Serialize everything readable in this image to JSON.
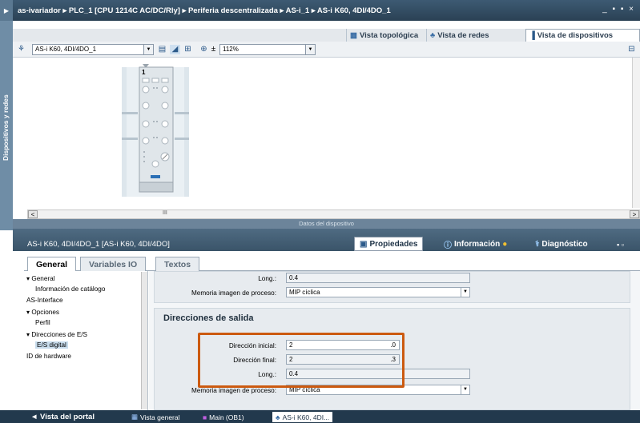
{
  "titlebar": {
    "breadcrumb": "as-ivariador  ▸  PLC_1 [CPU 1214C AC/DC/Rly]  ▸  Periferia descentralizada  ▸  AS-i_1  ▸  AS-i K60, 4DI/4DO_1",
    "window_buttons": "_ ▪ ▪ ×"
  },
  "sidebar": {
    "label": "Dispositivos y redes"
  },
  "view_tabs": {
    "topology": "Vista topológica",
    "network": "Vista de redes",
    "device": "Vista de dispositivos"
  },
  "toolbar": {
    "device_select": "AS-i K60, 4DI/4DO_1",
    "zoom": "112%",
    "zoom_icon": "± "
  },
  "device": {
    "slot_label": "1"
  },
  "canvas": {
    "device_data_label": "Datos del dispositivo",
    "scroll_marker": "III"
  },
  "inspector": {
    "title": "AS-i K60, 4DI/4DO_1 [AS-i K60, 4DI/4DO]",
    "tabs": {
      "properties": "Propiedades",
      "info": "Información",
      "diagnostics": "Diagnóstico"
    },
    "subtabs": [
      "General",
      "Variables IO",
      "Textos"
    ]
  },
  "tree": {
    "items": [
      {
        "label": "▾ General"
      },
      {
        "label": "Información de catálogo"
      },
      {
        "label": "AS-Interface"
      },
      {
        "label": "▾ Opciones"
      },
      {
        "label": "Perfil"
      },
      {
        "label": "▾ Direcciones de E/S"
      },
      {
        "label": "E/S digital"
      },
      {
        "label": "ID de hardware"
      }
    ]
  },
  "props": {
    "top_long_label": "Long.:",
    "top_long_value": "0.4",
    "top_mem_label": "Memoria imagen de proceso:",
    "top_mem_value": "MIP cíclica",
    "section_title": "Direcciones de salida",
    "start_label": "Dirección inicial:",
    "start_value": "2",
    "start_suffix": ".0",
    "end_label": "Dirección final:",
    "end_value": "2",
    "end_suffix": ".3",
    "long_label": "Long.:",
    "long_value": "0.4",
    "mem_label": "Memoria imagen de proceso:",
    "mem_value": "MIP cíclica"
  },
  "taskbar": {
    "portal": "◄  Vista del portal",
    "overview": "Vista general",
    "main": "Main (OB1)",
    "device": "AS-i K60, 4DI..."
  },
  "colors": {
    "highlight": "#cc5a10",
    "titlebar": "#2a4154"
  }
}
